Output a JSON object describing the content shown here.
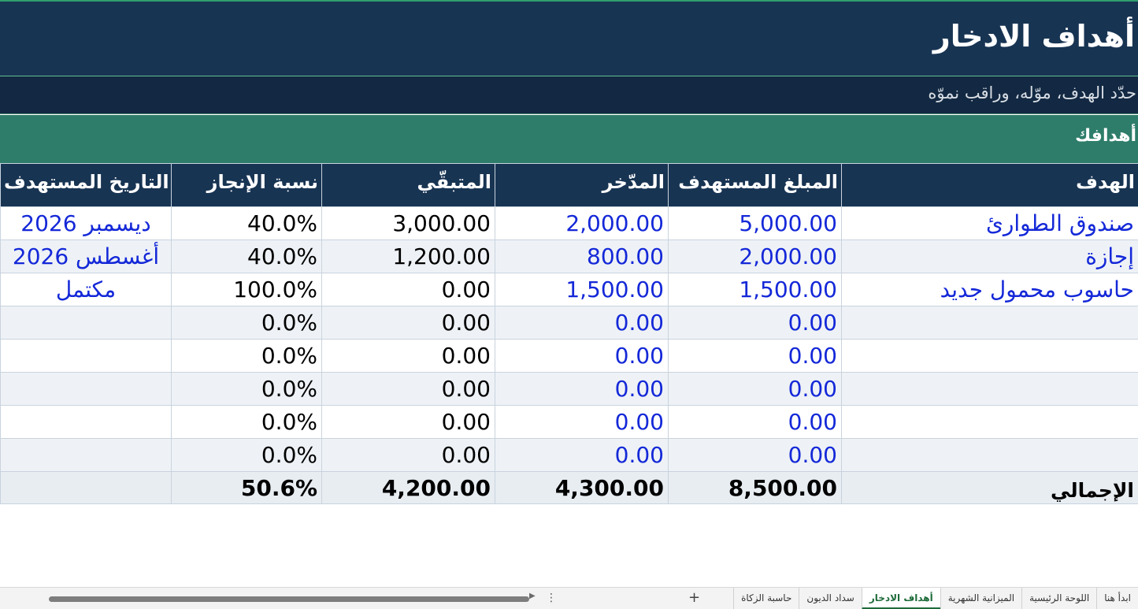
{
  "sheet": {
    "title": "أهداف الادخار",
    "subtitle": "حدّد الهدف، موّله، وراقب نموّه",
    "section_title": "أهدافك"
  },
  "table": {
    "headers": [
      "الهدف",
      "المبلغ المستهدف",
      "المدّخر",
      "المتبقّي",
      "نسبة الإنجاز",
      "التاريخ المستهدف"
    ],
    "rows": [
      {
        "goal": "صندوق الطوارئ",
        "target": "5,000.00",
        "saved": "2,000.00",
        "remaining": "3,000.00",
        "percent": "40.0%",
        "date": "ديسمبر 2026"
      },
      {
        "goal": "إجازة",
        "target": "2,000.00",
        "saved": "800.00",
        "remaining": "1,200.00",
        "percent": "40.0%",
        "date": "أغسطس 2026"
      },
      {
        "goal": "حاسوب محمول جديد",
        "target": "1,500.00",
        "saved": "1,500.00",
        "remaining": "0.00",
        "percent": "100.0%",
        "date": "مكتمل"
      },
      {
        "goal": "",
        "target": "0.00",
        "saved": "0.00",
        "remaining": "0.00",
        "percent": "0.0%",
        "date": ""
      },
      {
        "goal": "",
        "target": "0.00",
        "saved": "0.00",
        "remaining": "0.00",
        "percent": "0.0%",
        "date": ""
      },
      {
        "goal": "",
        "target": "0.00",
        "saved": "0.00",
        "remaining": "0.00",
        "percent": "0.0%",
        "date": ""
      },
      {
        "goal": "",
        "target": "0.00",
        "saved": "0.00",
        "remaining": "0.00",
        "percent": "0.0%",
        "date": ""
      },
      {
        "goal": "",
        "target": "0.00",
        "saved": "0.00",
        "remaining": "0.00",
        "percent": "0.0%",
        "date": ""
      }
    ],
    "total": {
      "label": "الإجمالي",
      "target": "8,500.00",
      "saved": "4,300.00",
      "remaining": "4,200.00",
      "percent": "50.6%"
    }
  },
  "tabs": {
    "items": [
      "ابدأ هنا",
      "اللوحة الرئيسية",
      "الميزانية الشهرية",
      "أهداف الادخار",
      "سداد الديون",
      "حاسبة الزكاة"
    ],
    "active_index": 3,
    "add_label": "+",
    "more_label": "⋮",
    "scroll_arrow": "▶"
  },
  "colors": {
    "title_bg": "#183453",
    "section_bg": "#2e7d6a",
    "input_text": "#1428d8",
    "active_tab": "#1d6b3a"
  }
}
